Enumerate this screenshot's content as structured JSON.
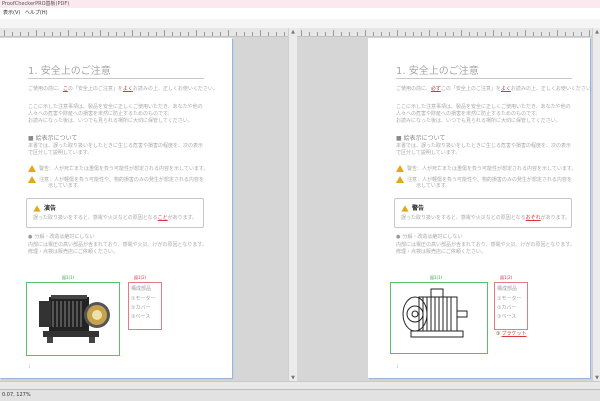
{
  "window": {
    "title": "ProofCheckerPRO基板(PDF)"
  },
  "menu": {
    "items": [
      "表示(V)",
      "ヘルプ(H)"
    ]
  },
  "status": {
    "coords": "0.07, 127%"
  },
  "left_page": {
    "title": "1. 安全上のご注意",
    "intro1": "ご使用の前に、この「安全上のご注意」をよくお読みの上、正しくお使いください。",
    "intro2": "ここに示した注意事項は、製品を安全に正しくご使用いただき、あなたや他の",
    "intro3": "人々への危害や財産への損害を未然に防止するためのものです。",
    "intro4": "お読みになった後は、いつでも見られる場所に大切に保管してください。",
    "section": "■ 絵表示について",
    "sec1": "本書では、誤った取り扱いをしたときに生じる危害や損害の程度を、次の表示",
    "sec2": "で区分して説明しています。",
    "w1": "警告：人が死亡または重傷を負う可能性が想定される内容を示しています。",
    "w2": "注意：人が軽傷を負う可能性や、物的損害のみの発生が想定される内容を",
    "w3": "示しています。",
    "callout_title": "演告",
    "callout_body": "誤った取り扱いをすると、感電や火災などの原因となることがあります。",
    "bul1": "分解・改造は絶対にしない",
    "bul2": "内部には電圧の高い部品が含まれており、感電や火災、けがの原因となります。",
    "bul3": "修理・点検は販売店にご依頼ください。",
    "green_label": "図1(1)",
    "red_label": "図1(2)",
    "parts": [
      "構成部品",
      "①モーター",
      "②カバー",
      "③ベース"
    ],
    "page_no": "1"
  },
  "right_page": {
    "title": "1. 安全上のご注意",
    "intro1": "ご使用の前に、必ずこの「安全上のご注意」をよくお読みの上、正しくお使いください。",
    "intro2": "ここに示した注意事項は、製品を安全に正しくご使用いただき、あなたや他の",
    "intro3": "人々への危害や財産への損害を未然に防止するためのものです。",
    "intro4": "お読みになった後は、いつでも見られる場所に大切に保管してください。",
    "section": "■ 絵表示について",
    "sec1": "本書では、誤った取り扱いをしたときに生じる危害や損害の程度を、次の表示",
    "sec2": "で区分して説明しています。",
    "w1": "警告：人が死亡または重傷を負う可能性が想定される内容を示しています。",
    "w2": "注意：人が軽傷を負う可能性や、物的損害のみの発生が想定される内容を",
    "w3": "示しています。",
    "callout_title": "警告",
    "callout_body": "誤った取り扱いをすると、感電や火災などの原因となるおそれがあります。",
    "bul1": "分解・改造は絶対にしない",
    "bul2": "内部には電圧の高い部品が含まれており、感電や火災、けがの原因となります。",
    "bul3": "修理・点検は販売店にご依頼ください。",
    "green_label": "図1(1)",
    "red_label": "図1(2)",
    "parts": [
      "構成部品",
      "①モーター",
      "②カバー",
      "③ベース"
    ],
    "bracket": "ブラケット",
    "page_no": "1"
  }
}
